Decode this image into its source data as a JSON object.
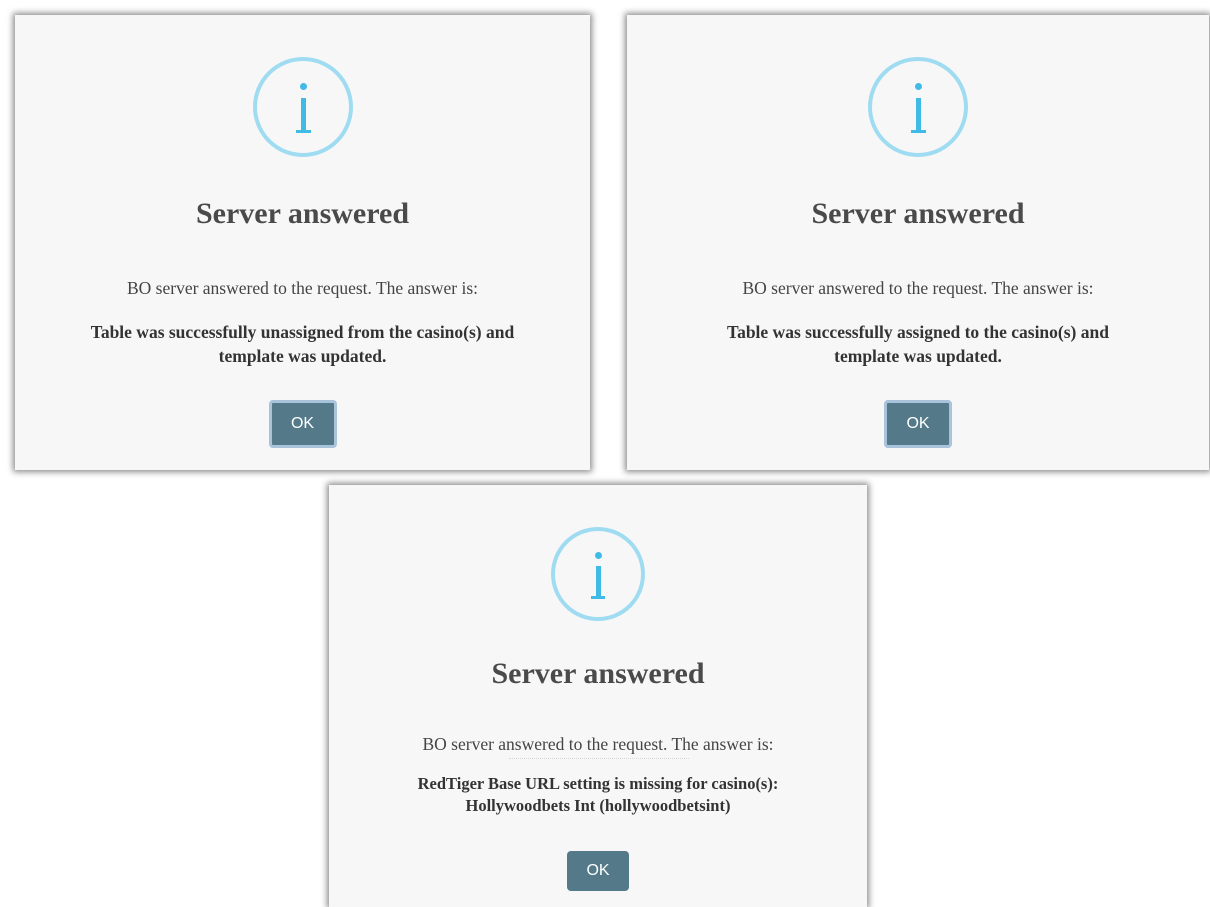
{
  "dialogs": [
    {
      "title": "Server answered",
      "subtitle": "BO server answered to the request. The answer is:",
      "message_line1": "Table was successfully unassigned from the casino(s) and",
      "message_line2": "template was updated.",
      "ok_label": "OK",
      "icon": "info-icon"
    },
    {
      "title": "Server answered",
      "subtitle": "BO server answered to the request. The answer is:",
      "message_line1": "Table was successfully assigned to the casino(s) and",
      "message_line2": "template was updated.",
      "ok_label": "OK",
      "icon": "info-icon"
    },
    {
      "title": "Server answered",
      "subtitle": "BO server answered to the request. The answer is:",
      "message_line1": "RedTiger Base URL setting is missing for casino(s):",
      "message_line2": "Hollywoodbets Int (hollywoodbetsint)",
      "ok_label": "OK",
      "icon": "info-icon"
    }
  ],
  "colors": {
    "dialog_background": "#f7f7f7",
    "icon_ring": "#9fdcf2",
    "icon_glyph": "#3fbbe6",
    "button_background": "#547a8a",
    "button_focus_ring": "#a9c3dc"
  }
}
